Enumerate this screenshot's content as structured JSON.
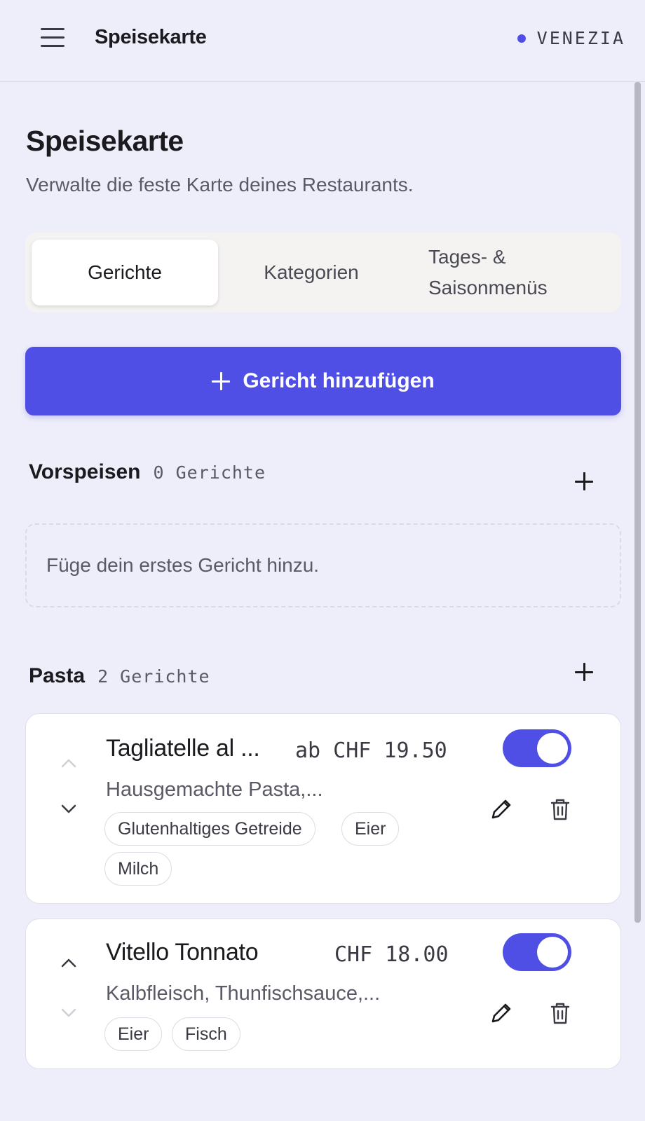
{
  "header": {
    "app_title": "Speisekarte",
    "tenant": "VENEZIA",
    "accent_color": "#4f4fe6"
  },
  "page": {
    "title": "Speisekarte",
    "subtitle": "Verwalte die feste Karte deines Restaurants."
  },
  "tabs": [
    {
      "label": "Gerichte",
      "active": true
    },
    {
      "label": "Kategorien",
      "active": false
    },
    {
      "label_line1": "Tages- &",
      "label_line2": "Saisonmenüs",
      "active": false
    }
  ],
  "add_dish_button": "Gericht hinzufügen",
  "sections": [
    {
      "name": "Vorspeisen",
      "count": "0 Gerichte",
      "empty_text": "Füge dein erstes Gericht hinzu."
    },
    {
      "name": "Pasta",
      "count": "2 Gerichte",
      "dishes": [
        {
          "name": "Tagliatelle al ...",
          "price": "ab CHF 19.50",
          "description": "Hausgemachte Pasta,...",
          "tags": [
            "Glutenhaltiges Getreide",
            "Eier",
            "Milch"
          ],
          "active": true
        },
        {
          "name": "Vitello Tonnato",
          "price": "CHF 18.00",
          "description": "Kalbfleisch, Thunfischsauce,...",
          "tags": [
            "Eier",
            "Fisch"
          ],
          "active": true
        }
      ]
    }
  ]
}
